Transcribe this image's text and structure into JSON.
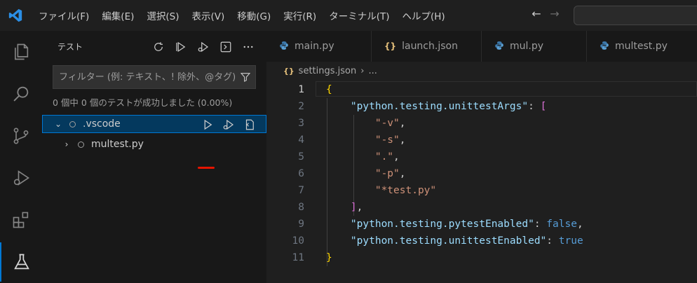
{
  "menu": [
    "ファイル(F)",
    "編集(E)",
    "選択(S)",
    "表示(V)",
    "移動(G)",
    "実行(R)",
    "ターミナル(T)",
    "ヘルプ(H)"
  ],
  "nav": {
    "back": "←",
    "forward": "→"
  },
  "sidebar": {
    "title": "テスト",
    "filter_placeholder": "フィルター (例: テキスト、! 除外、@タグ)",
    "summary": "0 個中 0 個のテストが成功しました (0.00%)",
    "tree": [
      {
        "label": ".vscode",
        "chevron": "⌄"
      },
      {
        "label": "multest.py",
        "chevron": "›"
      }
    ]
  },
  "tabs": [
    {
      "label": "main.py",
      "icon": "python-icon"
    },
    {
      "label": "launch.json",
      "icon": "json-icon"
    },
    {
      "label": "mul.py",
      "icon": "python-icon"
    },
    {
      "label": "multest.py",
      "icon": "python-icon"
    }
  ],
  "breadcrumb": {
    "file": "settings.json",
    "sep": "›",
    "rest": "..."
  },
  "code": {
    "line_numbers": [
      "1",
      "2",
      "3",
      "4",
      "5",
      "6",
      "7",
      "8",
      "9",
      "10",
      "11"
    ],
    "lines": [
      [
        {
          "t": "{",
          "c": "b1"
        }
      ],
      [
        {
          "t": "    "
        },
        {
          "t": "\"python.testing.unittestArgs\"",
          "c": "k"
        },
        {
          "t": ": ",
          "c": "p"
        },
        {
          "t": "[",
          "c": "b2"
        }
      ],
      [
        {
          "t": "        "
        },
        {
          "t": "\"-v\"",
          "c": "s"
        },
        {
          "t": ",",
          "c": "p"
        }
      ],
      [
        {
          "t": "        "
        },
        {
          "t": "\"-s\"",
          "c": "s"
        },
        {
          "t": ",",
          "c": "p"
        }
      ],
      [
        {
          "t": "        "
        },
        {
          "t": "\".\"",
          "c": "s"
        },
        {
          "t": ",",
          "c": "p"
        }
      ],
      [
        {
          "t": "        "
        },
        {
          "t": "\"-p\"",
          "c": "s"
        },
        {
          "t": ",",
          "c": "p"
        }
      ],
      [
        {
          "t": "        "
        },
        {
          "t": "\"*test.py\"",
          "c": "s"
        }
      ],
      [
        {
          "t": "    "
        },
        {
          "t": "]",
          "c": "b2"
        },
        {
          "t": ",",
          "c": "p"
        }
      ],
      [
        {
          "t": "    "
        },
        {
          "t": "\"python.testing.pytestEnabled\"",
          "c": "k"
        },
        {
          "t": ": ",
          "c": "p"
        },
        {
          "t": "false",
          "c": "kw"
        },
        {
          "t": ",",
          "c": "p"
        }
      ],
      [
        {
          "t": "    "
        },
        {
          "t": "\"python.testing.unittestEnabled\"",
          "c": "k"
        },
        {
          "t": ": ",
          "c": "p"
        },
        {
          "t": "true",
          "c": "kw"
        }
      ],
      [
        {
          "t": "}",
          "c": "b1"
        }
      ]
    ]
  },
  "colors": {
    "accent": "#0078d4",
    "selection": "#04395e",
    "underline": "#e51400"
  }
}
